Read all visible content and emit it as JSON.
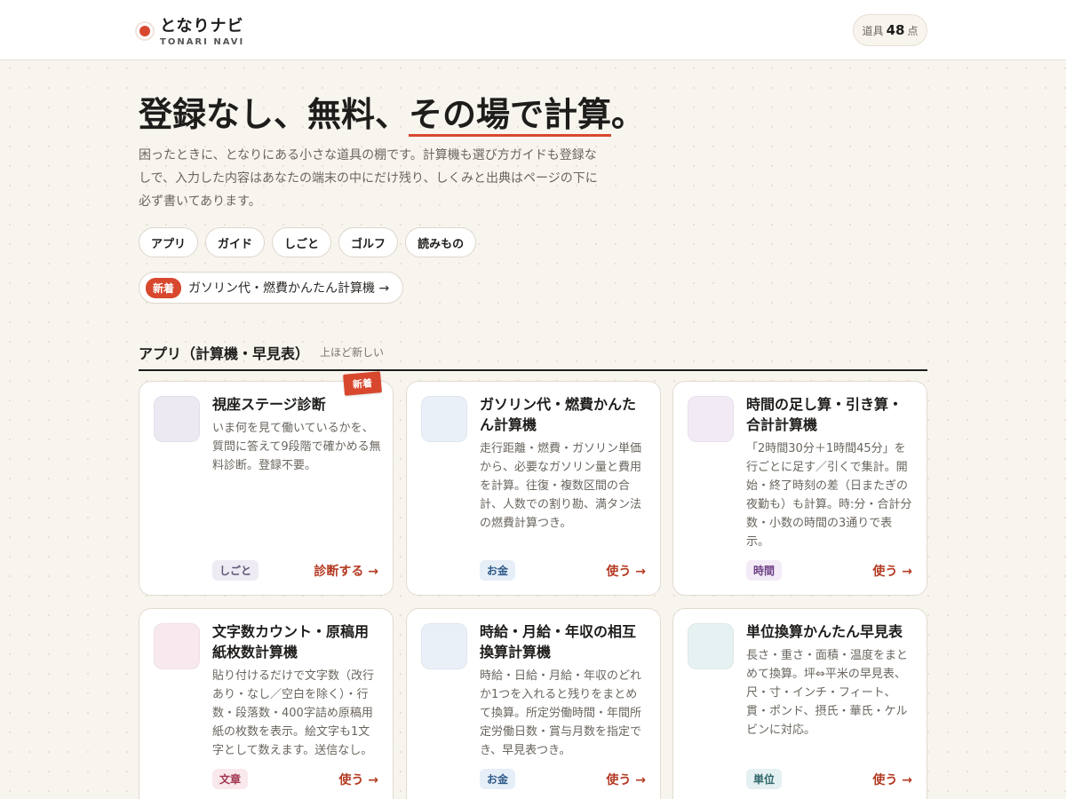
{
  "header": {
    "logo_name": "となりナビ",
    "logo_sub": "TONARI NAVI",
    "tool_count_prefix": "道具",
    "tool_count_value": "48",
    "tool_count_suffix": "点"
  },
  "hero": {
    "title_part1": "登録なし、無料、",
    "title_part2": "その場で計算",
    "title_part3": "。",
    "description": "困ったときに、となりにある小さな道具の棚です。計算機も選び方ガイドも登録なしで、入力した内容はあなたの端末の中にだけ残り、しくみと出典はページの下に必ず書いてあります。"
  },
  "categories": [
    "アプリ",
    "ガイド",
    "しごと",
    "ゴルフ",
    "読みもの"
  ],
  "new_banner": {
    "tag": "新着",
    "link": "ガソリン代・燃費かんたん計算機 →"
  },
  "section": {
    "title": "アプリ（計算機・早見表）",
    "note": "上ほど新しい"
  },
  "ribbon_label": "新着",
  "cards": [
    {
      "title": "視座ステージ診断",
      "description": "いま何を見て働いているかを、質問に答えて9段階で確かめる無料診断。登録不要。",
      "tag": "しごと",
      "action": "診断する →",
      "thumb_color": "#ece9f3",
      "tag_bg": "#eeebf4",
      "tag_color": "#5e5675"
    },
    {
      "title": "ガソリン代・燃費かんたん計算機",
      "description": "走行距離・燃費・ガソリン単価から、必要なガソリン量と費用を計算。往復・複数区間の合計、人数での割り勘、満タン法の燃費計算つき。",
      "tag": "お金",
      "action": "使う →",
      "thumb_color": "#e9f0f8",
      "tag_bg": "#e6eef8",
      "tag_color": "#2f5b8a"
    },
    {
      "title": "時間の足し算・引き算・合計計算機",
      "description": "「2時間30分＋1時間45分」を行ごとに足す／引くで集計。開始・終了時刻の差（日またぎの夜勤も）も計算。時:分・合計分数・小数の時間の3通りで表示。",
      "tag": "時間",
      "action": "使う →",
      "thumb_color": "#f2ebf6",
      "tag_bg": "#f3ebf7",
      "tag_color": "#6e3f86"
    },
    {
      "title": "文字数カウント・原稿用紙枚数計算機",
      "description": "貼り付けるだけで文字数（改行あり・なし／空白を除く）・行数・段落数・400字詰め原稿用紙の枚数を表示。絵文字も1文字として数えます。送信なし。",
      "tag": "文章",
      "action": "使う →",
      "thumb_color": "#f8e9ee",
      "tag_bg": "#f9e8ec",
      "tag_color": "#a0364f"
    },
    {
      "title": "時給・月給・年収の相互換算計算機",
      "description": "時給・日給・月給・年収のどれか1つを入れると残りをまとめて換算。所定労働時間・年間所定労働日数・賞与月数を指定でき、早見表つき。",
      "tag": "お金",
      "action": "使う →",
      "thumb_color": "#e9f0f8",
      "tag_bg": "#e6eef8",
      "tag_color": "#2f5b8a"
    },
    {
      "title": "単位換算かんたん早見表",
      "description": "長さ・重さ・面積・温度をまとめて換算。坪⇔平米の早見表、尺・寸・インチ・フィート、貫・ポンド、摂氏・華氏・ケルビンに対応。",
      "tag": "単位",
      "action": "使う →",
      "thumb_color": "#e6f1f1",
      "tag_bg": "#e4f0f1",
      "tag_color": "#2d6468"
    }
  ]
}
